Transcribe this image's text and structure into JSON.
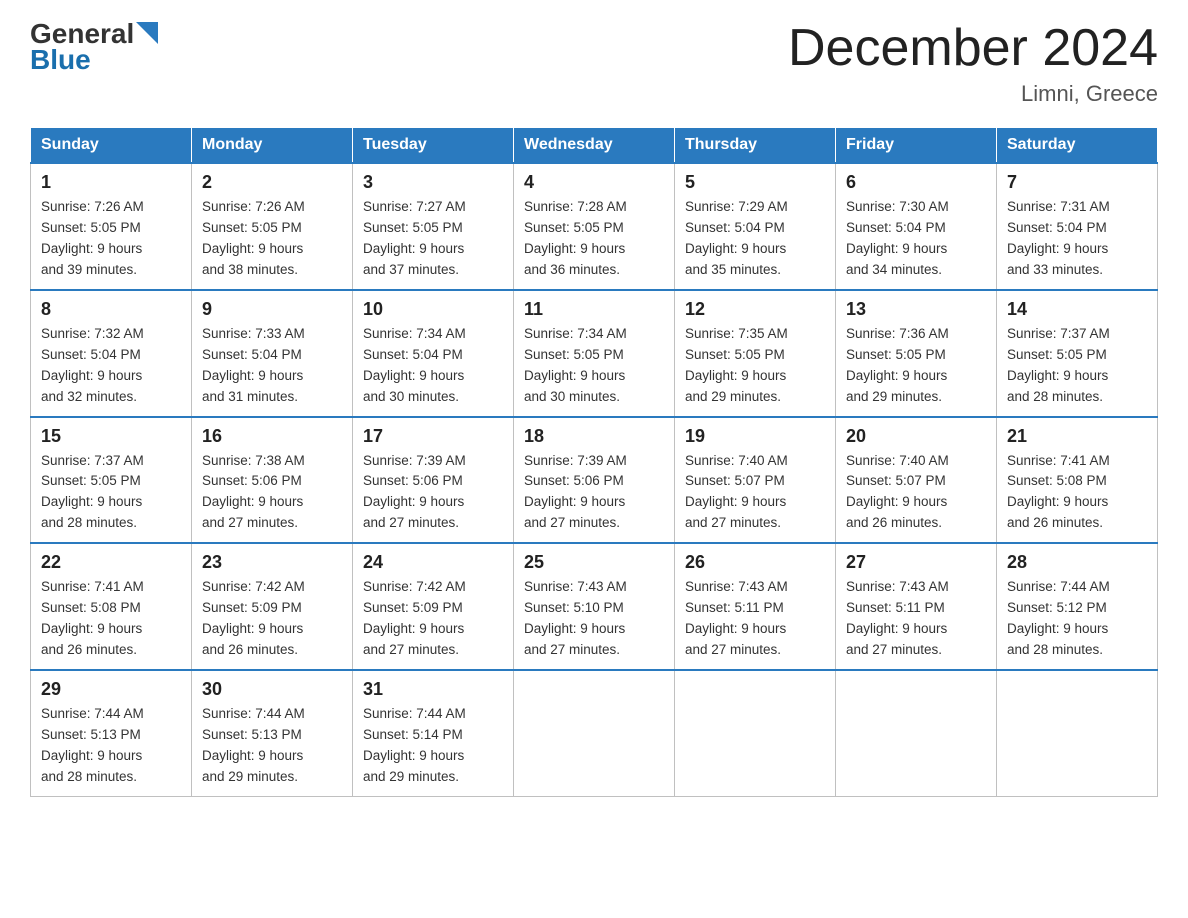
{
  "header": {
    "logo_general": "General",
    "logo_blue": "Blue",
    "month_title": "December 2024",
    "location": "Limni, Greece"
  },
  "days_of_week": [
    "Sunday",
    "Monday",
    "Tuesday",
    "Wednesday",
    "Thursday",
    "Friday",
    "Saturday"
  ],
  "weeks": [
    [
      {
        "day": "1",
        "info": "Sunrise: 7:26 AM\nSunset: 5:05 PM\nDaylight: 9 hours\nand 39 minutes."
      },
      {
        "day": "2",
        "info": "Sunrise: 7:26 AM\nSunset: 5:05 PM\nDaylight: 9 hours\nand 38 minutes."
      },
      {
        "day": "3",
        "info": "Sunrise: 7:27 AM\nSunset: 5:05 PM\nDaylight: 9 hours\nand 37 minutes."
      },
      {
        "day": "4",
        "info": "Sunrise: 7:28 AM\nSunset: 5:05 PM\nDaylight: 9 hours\nand 36 minutes."
      },
      {
        "day": "5",
        "info": "Sunrise: 7:29 AM\nSunset: 5:04 PM\nDaylight: 9 hours\nand 35 minutes."
      },
      {
        "day": "6",
        "info": "Sunrise: 7:30 AM\nSunset: 5:04 PM\nDaylight: 9 hours\nand 34 minutes."
      },
      {
        "day": "7",
        "info": "Sunrise: 7:31 AM\nSunset: 5:04 PM\nDaylight: 9 hours\nand 33 minutes."
      }
    ],
    [
      {
        "day": "8",
        "info": "Sunrise: 7:32 AM\nSunset: 5:04 PM\nDaylight: 9 hours\nand 32 minutes."
      },
      {
        "day": "9",
        "info": "Sunrise: 7:33 AM\nSunset: 5:04 PM\nDaylight: 9 hours\nand 31 minutes."
      },
      {
        "day": "10",
        "info": "Sunrise: 7:34 AM\nSunset: 5:04 PM\nDaylight: 9 hours\nand 30 minutes."
      },
      {
        "day": "11",
        "info": "Sunrise: 7:34 AM\nSunset: 5:05 PM\nDaylight: 9 hours\nand 30 minutes."
      },
      {
        "day": "12",
        "info": "Sunrise: 7:35 AM\nSunset: 5:05 PM\nDaylight: 9 hours\nand 29 minutes."
      },
      {
        "day": "13",
        "info": "Sunrise: 7:36 AM\nSunset: 5:05 PM\nDaylight: 9 hours\nand 29 minutes."
      },
      {
        "day": "14",
        "info": "Sunrise: 7:37 AM\nSunset: 5:05 PM\nDaylight: 9 hours\nand 28 minutes."
      }
    ],
    [
      {
        "day": "15",
        "info": "Sunrise: 7:37 AM\nSunset: 5:05 PM\nDaylight: 9 hours\nand 28 minutes."
      },
      {
        "day": "16",
        "info": "Sunrise: 7:38 AM\nSunset: 5:06 PM\nDaylight: 9 hours\nand 27 minutes."
      },
      {
        "day": "17",
        "info": "Sunrise: 7:39 AM\nSunset: 5:06 PM\nDaylight: 9 hours\nand 27 minutes."
      },
      {
        "day": "18",
        "info": "Sunrise: 7:39 AM\nSunset: 5:06 PM\nDaylight: 9 hours\nand 27 minutes."
      },
      {
        "day": "19",
        "info": "Sunrise: 7:40 AM\nSunset: 5:07 PM\nDaylight: 9 hours\nand 27 minutes."
      },
      {
        "day": "20",
        "info": "Sunrise: 7:40 AM\nSunset: 5:07 PM\nDaylight: 9 hours\nand 26 minutes."
      },
      {
        "day": "21",
        "info": "Sunrise: 7:41 AM\nSunset: 5:08 PM\nDaylight: 9 hours\nand 26 minutes."
      }
    ],
    [
      {
        "day": "22",
        "info": "Sunrise: 7:41 AM\nSunset: 5:08 PM\nDaylight: 9 hours\nand 26 minutes."
      },
      {
        "day": "23",
        "info": "Sunrise: 7:42 AM\nSunset: 5:09 PM\nDaylight: 9 hours\nand 26 minutes."
      },
      {
        "day": "24",
        "info": "Sunrise: 7:42 AM\nSunset: 5:09 PM\nDaylight: 9 hours\nand 27 minutes."
      },
      {
        "day": "25",
        "info": "Sunrise: 7:43 AM\nSunset: 5:10 PM\nDaylight: 9 hours\nand 27 minutes."
      },
      {
        "day": "26",
        "info": "Sunrise: 7:43 AM\nSunset: 5:11 PM\nDaylight: 9 hours\nand 27 minutes."
      },
      {
        "day": "27",
        "info": "Sunrise: 7:43 AM\nSunset: 5:11 PM\nDaylight: 9 hours\nand 27 minutes."
      },
      {
        "day": "28",
        "info": "Sunrise: 7:44 AM\nSunset: 5:12 PM\nDaylight: 9 hours\nand 28 minutes."
      }
    ],
    [
      {
        "day": "29",
        "info": "Sunrise: 7:44 AM\nSunset: 5:13 PM\nDaylight: 9 hours\nand 28 minutes."
      },
      {
        "day": "30",
        "info": "Sunrise: 7:44 AM\nSunset: 5:13 PM\nDaylight: 9 hours\nand 29 minutes."
      },
      {
        "day": "31",
        "info": "Sunrise: 7:44 AM\nSunset: 5:14 PM\nDaylight: 9 hours\nand 29 minutes."
      },
      null,
      null,
      null,
      null
    ]
  ]
}
